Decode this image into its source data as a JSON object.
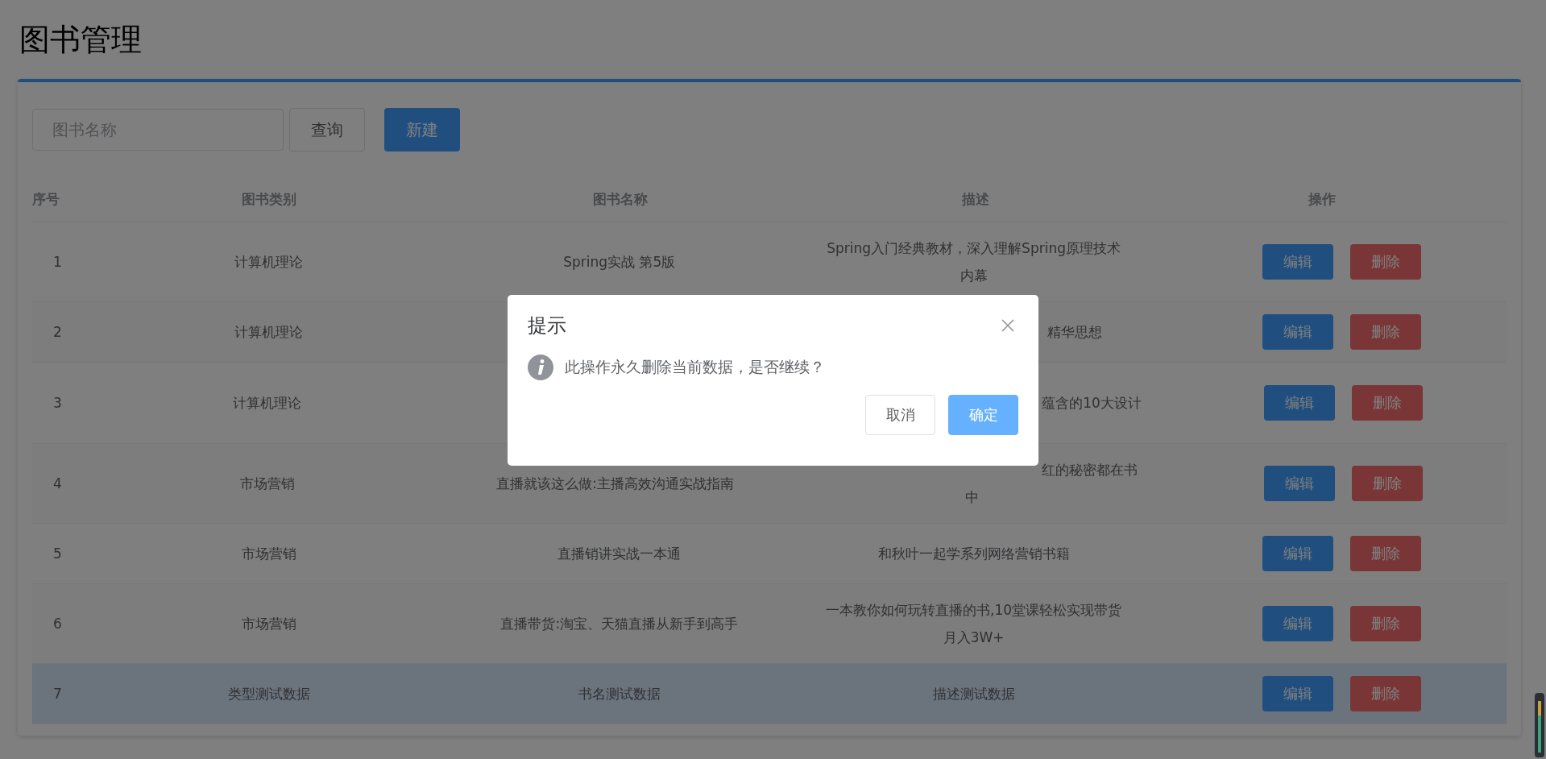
{
  "page": {
    "title": "图书管理"
  },
  "toolbar": {
    "search": {
      "placeholder": "图书名称"
    },
    "buttons": [
      {
        "label": "查询",
        "kind": "default"
      },
      {
        "label": "新建",
        "kind": "primary"
      }
    ]
  },
  "table": {
    "columns": [
      "序号",
      "图书类别",
      "图书名称",
      "描述",
      "操作"
    ],
    "rows": [
      {
        "index": "1",
        "category": "计算机理论",
        "name": "Spring实战 第5版",
        "description": [
          {
            "text": "Spring入门经典教材，深入理解Spring原理技术",
            "kind": "whole"
          },
          {
            "text": "内幕",
            "kind": "whole"
          }
        ],
        "actions": [
          {
            "label": "编辑",
            "kind": "primary"
          },
          {
            "label": "删除",
            "kind": "danger"
          }
        ],
        "selected": false
      },
      {
        "index": "2",
        "category": "计算机理论",
        "description": [
          {
            "text": "精华思想",
            "kind": "partial"
          }
        ],
        "actions": [
          {
            "label": "编辑",
            "kind": "primary"
          },
          {
            "label": "删除",
            "kind": "danger"
          }
        ],
        "selected": false
      },
      {
        "index": "3",
        "category": "计算机理论",
        "tall": true,
        "description": [
          {
            "text": "蕴含的10大设计",
            "kind": "partial"
          }
        ],
        "actions": [
          {
            "label": "编辑",
            "kind": "primary"
          },
          {
            "label": "删除",
            "kind": "danger"
          }
        ],
        "selected": false
      },
      {
        "index": "4",
        "category": "市场营销",
        "name": "直播就该这么做:主播高效沟通实战指南",
        "description": [
          {
            "text": "红的秘密都在书",
            "kind": "partial"
          },
          {
            "text": "中",
            "kind": "whole"
          }
        ],
        "actions": [
          {
            "label": "编辑",
            "kind": "primary"
          },
          {
            "label": "删除",
            "kind": "danger"
          }
        ],
        "selected": false
      },
      {
        "index": "5",
        "category": "市场营销",
        "name": "直播销讲实战一本通",
        "description": [
          {
            "text": "和秋叶一起学系列网络营销书籍",
            "kind": "whole"
          }
        ],
        "actions": [
          {
            "label": "编辑",
            "kind": "primary"
          },
          {
            "label": "删除",
            "kind": "danger"
          }
        ],
        "selected": false
      },
      {
        "index": "6",
        "category": "市场营销",
        "name": "直播带货:淘宝、天猫直播从新手到高手",
        "description": [
          {
            "text": "一本教你如何玩转直播的书,10堂课轻松实现带货",
            "kind": "whole"
          },
          {
            "text": "月入3W+",
            "kind": "whole"
          }
        ],
        "actions": [
          {
            "label": "编辑",
            "kind": "primary"
          },
          {
            "label": "删除",
            "kind": "danger"
          }
        ],
        "selected": false
      },
      {
        "index": "7",
        "category": "类型测试数据",
        "name": "书名测试数据",
        "description": [
          {
            "text": "描述测试数据",
            "kind": "whole"
          }
        ],
        "actions": [
          {
            "label": "编辑",
            "kind": "primary"
          },
          {
            "label": "删除",
            "kind": "danger"
          }
        ],
        "selected": true
      }
    ]
  },
  "dialog": {
    "title": "提示",
    "message": "此操作永久删除当前数据，是否继续？",
    "buttons": [
      {
        "label": "取消",
        "kind": "default"
      },
      {
        "label": "确定",
        "kind": "primary"
      }
    ]
  }
}
